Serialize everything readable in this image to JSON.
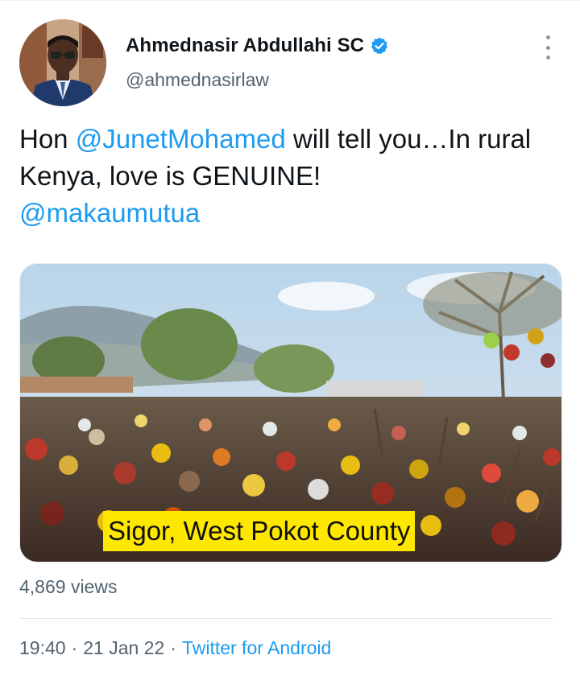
{
  "author": {
    "display_name": "Ahmednasir Abdullahi SC",
    "handle": "@ahmednasirlaw",
    "verified": true,
    "verified_icon": "verified-badge-icon"
  },
  "tweet": {
    "text_lead": "Hon ",
    "mention_1": "@JunetMohamed",
    "text_mid": " will tell you…In rural Kenya, love is GENUINE!",
    "mention_2": "@makaumutua"
  },
  "media": {
    "type": "video",
    "caption": "Sigor, West Pokot County"
  },
  "stats": {
    "views": "4,869 views"
  },
  "meta": {
    "time": "19:40",
    "separator": "·",
    "date": "21 Jan 22",
    "source": "Twitter for Android"
  },
  "colors": {
    "accent": "#1d9bf0",
    "text": "#0f1419",
    "secondary": "#536471",
    "caption_bg": "#ffe800"
  }
}
